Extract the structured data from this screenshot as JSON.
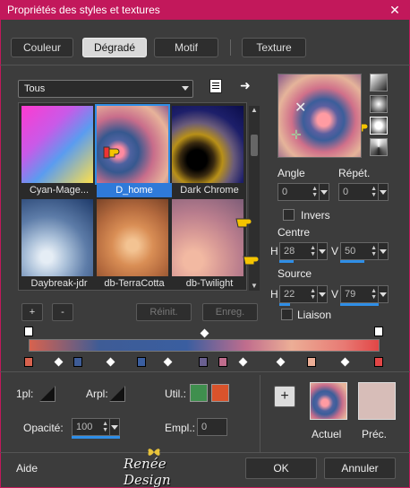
{
  "window": {
    "title": "Propriétés des styles et textures",
    "close_glyph": "✕"
  },
  "tabs": [
    {
      "label": "Couleur"
    },
    {
      "label": "Dégradé",
      "active": true
    },
    {
      "label": "Motif"
    },
    {
      "label": "Texture"
    }
  ],
  "category": {
    "selected": "Tous"
  },
  "gallery": {
    "items": [
      {
        "label": "Cyan-Mage..."
      },
      {
        "label": "D_home",
        "selected": true
      },
      {
        "label": "Dark Chrome"
      },
      {
        "label": "Daybreak-jdr"
      },
      {
        "label": "db-TerraCotta"
      },
      {
        "label": "db-Twilight"
      }
    ]
  },
  "buttons": {
    "add": "+",
    "remove": "-",
    "reset": "Réinit.",
    "save": "Enreg."
  },
  "params": {
    "angle_label": "Angle",
    "angle_value": "0",
    "repeat_label": "Répét.",
    "repeat_value": "0",
    "invert_label": "Invers",
    "center_label": "Centre",
    "center_h_label": "H",
    "center_h": "28",
    "center_v_label": "V",
    "center_v": "50",
    "source_label": "Source",
    "source_h_label": "H",
    "source_h": "22",
    "source_v_label": "V",
    "source_v": "79",
    "link_label": "Liaison"
  },
  "bottom": {
    "pl1_label": "1pl:",
    "arpl_label": "Arpl:",
    "util_label": "Util.:",
    "util_colors": [
      "#3f8f4e",
      "#d9532b"
    ],
    "opacity_label": "Opacité:",
    "opacity_value": "100",
    "empl_label": "Empl.:",
    "empl_value": "0",
    "add_glyph": "+",
    "current_label": "Actuel",
    "previous_label": "Préc."
  },
  "footer": {
    "help": "Aide",
    "brand": "Renée Design",
    "ok": "OK",
    "cancel": "Annuler"
  }
}
